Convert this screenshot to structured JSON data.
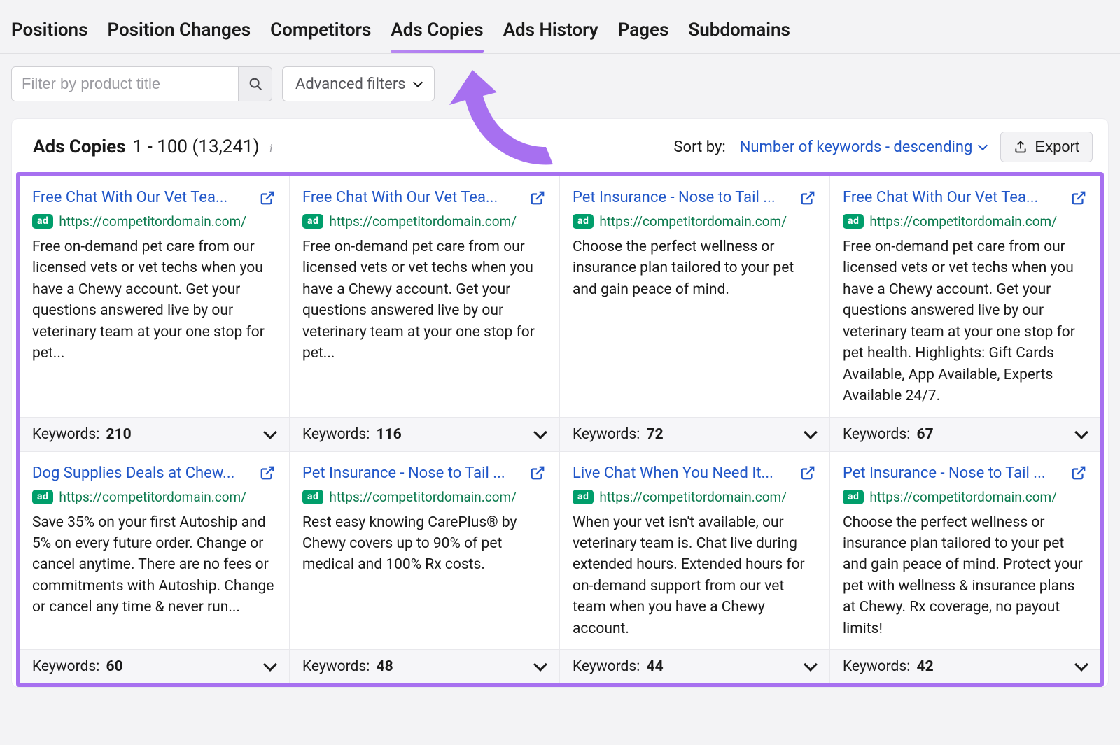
{
  "tabs": [
    "Positions",
    "Position Changes",
    "Competitors",
    "Ads Copies",
    "Ads History",
    "Pages",
    "Subdomains"
  ],
  "activeTab": 3,
  "filters": {
    "placeholder": "Filter by product title",
    "advanced": "Advanced filters"
  },
  "panel": {
    "title": "Ads Copies",
    "range": "1 - 100 (13,241)",
    "sortLabel": "Sort by:",
    "sortValue": "Number of keywords - descending",
    "export": "Export"
  },
  "ads": [
    {
      "title": "Free Chat With Our Vet Tea...",
      "url": "https://competitordomain.com/",
      "desc": "Free on-demand pet care from our licensed vets or vet techs when you have a Chewy account. Get your questions answered live by our veterinary team at your one stop for pet...",
      "keywords": "210"
    },
    {
      "title": "Free Chat With Our Vet Tea...",
      "url": "https://competitordomain.com/",
      "desc": "Free on-demand pet care from our licensed vets or vet techs when you have a Chewy account. Get your questions answered live by our veterinary team at your one stop for pet...",
      "keywords": "116"
    },
    {
      "title": "Pet Insurance - Nose to Tail ...",
      "url": "https://competitordomain.com/",
      "desc": "Choose the perfect wellness or insurance plan tailored to your pet and gain peace of mind.",
      "keywords": "72"
    },
    {
      "title": "Free Chat With Our Vet Tea...",
      "url": "https://competitordomain.com/",
      "desc": "Free on-demand pet care from our licensed vets or vet techs when you have a Chewy account. Get your questions answered live by our veterinary team at your one stop for pet health. Highlights: Gift Cards Available, App Available, Experts Available 24/7.",
      "keywords": "67"
    },
    {
      "title": "Dog Supplies Deals at Chew...",
      "url": "https://competitordomain.com/",
      "desc": "Save 35% on your first Autoship and 5% on every future order. Change or cancel anytime. There are no fees or commitments with Autoship. Change or cancel any time & never run...",
      "keywords": "60"
    },
    {
      "title": "Pet Insurance - Nose to Tail ...",
      "url": "https://competitordomain.com/",
      "desc": "Rest easy knowing CarePlus® by Chewy covers up to 90% of pet medical and 100% Rx costs.",
      "keywords": "48"
    },
    {
      "title": "Live Chat When You Need It...",
      "url": "https://competitordomain.com/",
      "desc": "When your vet isn't available, our veterinary team is. Chat live during extended hours. Extended hours for on-demand support from our vet team when you have a Chewy account.",
      "keywords": "44"
    },
    {
      "title": "Pet Insurance - Nose to Tail ...",
      "url": "https://competitordomain.com/",
      "desc": "Choose the perfect wellness or insurance plan tailored to your pet and gain peace of mind. Protect your pet with wellness & insurance plans at Chewy. Rx coverage, no payout limits!",
      "keywords": "42"
    }
  ],
  "labels": {
    "ad": "ad",
    "keywords": "Keywords:"
  }
}
